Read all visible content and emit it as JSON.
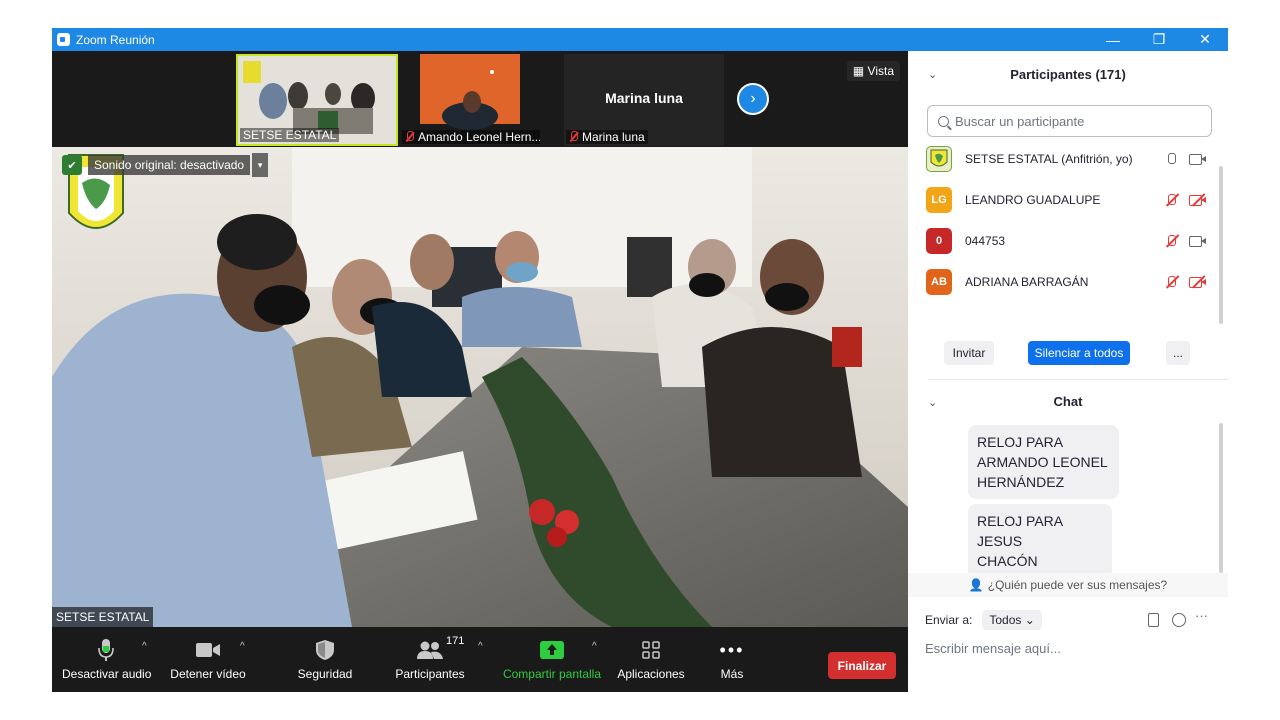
{
  "window": {
    "title": "Zoom Reunión",
    "minimize": "—",
    "restore": "❐",
    "close": "✕"
  },
  "strip": {
    "thumbs": [
      {
        "name": "SETSE ESTATAL"
      },
      {
        "name": "Amando Leonel Hern..."
      },
      {
        "name": "Marina luna",
        "big_name": "Marina luna"
      }
    ],
    "view_label": "Vista",
    "next": "›"
  },
  "main_video": {
    "speaker": "SETSE ESTATAL",
    "audio_badge": "Sonido original: desactivado",
    "dropdown": "▾"
  },
  "toolbar": {
    "mute": "Desactivar audio",
    "video": "Detener vídeo",
    "security": "Seguridad",
    "participants": "Participantes",
    "participants_count": "171",
    "share": "Compartir pantalla",
    "apps": "Aplicaciones",
    "more": "Más",
    "end": "Finalizar",
    "caret": "^"
  },
  "participants_panel": {
    "title": "Participantes (171)",
    "search_placeholder": "Buscar un participante",
    "list": [
      {
        "name": "SETSE ESTATAL (Anfitrión, yo)",
        "initials": "",
        "color": "#e8efc8",
        "mic_muted": false,
        "cam_off": false
      },
      {
        "name": "LEANDRO GUADALUPE",
        "initials": "LG",
        "color": "#f2a516",
        "mic_muted": true,
        "cam_off": true
      },
      {
        "name": "044753",
        "initials": "0",
        "color": "#c62828",
        "mic_muted": true,
        "cam_off": false
      },
      {
        "name": "ADRIANA BARRAGÁN",
        "initials": "AB",
        "color": "#e0651a",
        "mic_muted": true,
        "cam_off": true
      }
    ],
    "invite": "Invitar",
    "mute_all": "Silenciar a todos",
    "more": "..."
  },
  "chat_panel": {
    "title": "Chat",
    "messages": [
      {
        "text_lines": [
          "RELOJ PARA",
          "ARMANDO LEONEL",
          "HERNÁNDEZ"
        ]
      },
      {
        "text_lines": [
          "RELOJ PARA JESUS",
          "CHACÓN"
        ]
      }
    ],
    "who_sees": "¿Quién puede ver sus mensajes?",
    "send_to_label": "Enviar a:",
    "send_to_value": "Todos",
    "input_placeholder": "Escribir mensaje aquí..."
  },
  "colors": {
    "accent": "#0e71eb",
    "titlebar": "#1e88e5",
    "end": "#d32f2f",
    "share": "#2ecc40"
  }
}
